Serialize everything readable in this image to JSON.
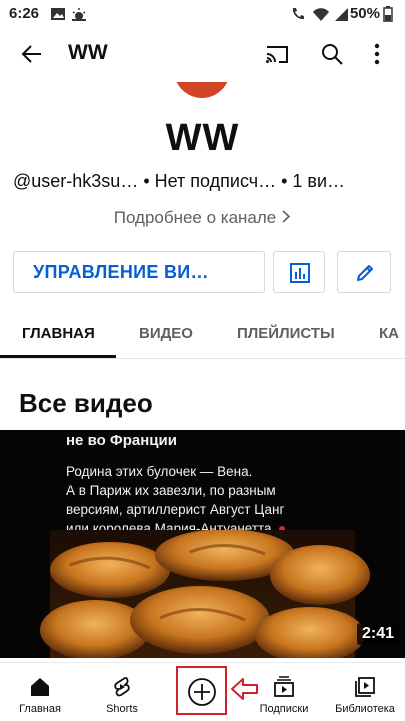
{
  "status_bar": {
    "time": "6:26",
    "battery": "50%"
  },
  "app_bar": {
    "title": "WW"
  },
  "channel": {
    "name": "WW",
    "meta": "@user-hk3su… • Нет подписч… • 1 ви…",
    "more_link": "Подробнее о канале"
  },
  "actions": {
    "manage_label": "УПРАВЛЕНИЕ ВИ…"
  },
  "tabs": [
    {
      "label": "ГЛАВНАЯ",
      "active": true
    },
    {
      "label": "ВИДЕО"
    },
    {
      "label": "ПЛЕЙЛИСТЫ"
    },
    {
      "label": "КА"
    }
  ],
  "section_title": "Все видео",
  "video": {
    "headline": "не во Франции",
    "body_lines": [
      "Родина этих булочек — Вена.",
      "А в Париж их завезли, по разным",
      "версиям, артиллерист Август Цанг",
      "или королева Мария-Антуанетта."
    ],
    "duration": "2:41"
  },
  "bottom_nav": [
    {
      "label": "Главная",
      "icon": "home-icon"
    },
    {
      "label": "Shorts",
      "icon": "shorts-icon"
    },
    {
      "label": "",
      "icon": "create-icon"
    },
    {
      "label": "Подписки",
      "icon": "subscriptions-icon"
    },
    {
      "label": "Библиотека",
      "icon": "library-icon"
    }
  ],
  "colors": {
    "accent": "#065fd4",
    "highlight": "#d0202a",
    "avatar": "#d14424"
  }
}
